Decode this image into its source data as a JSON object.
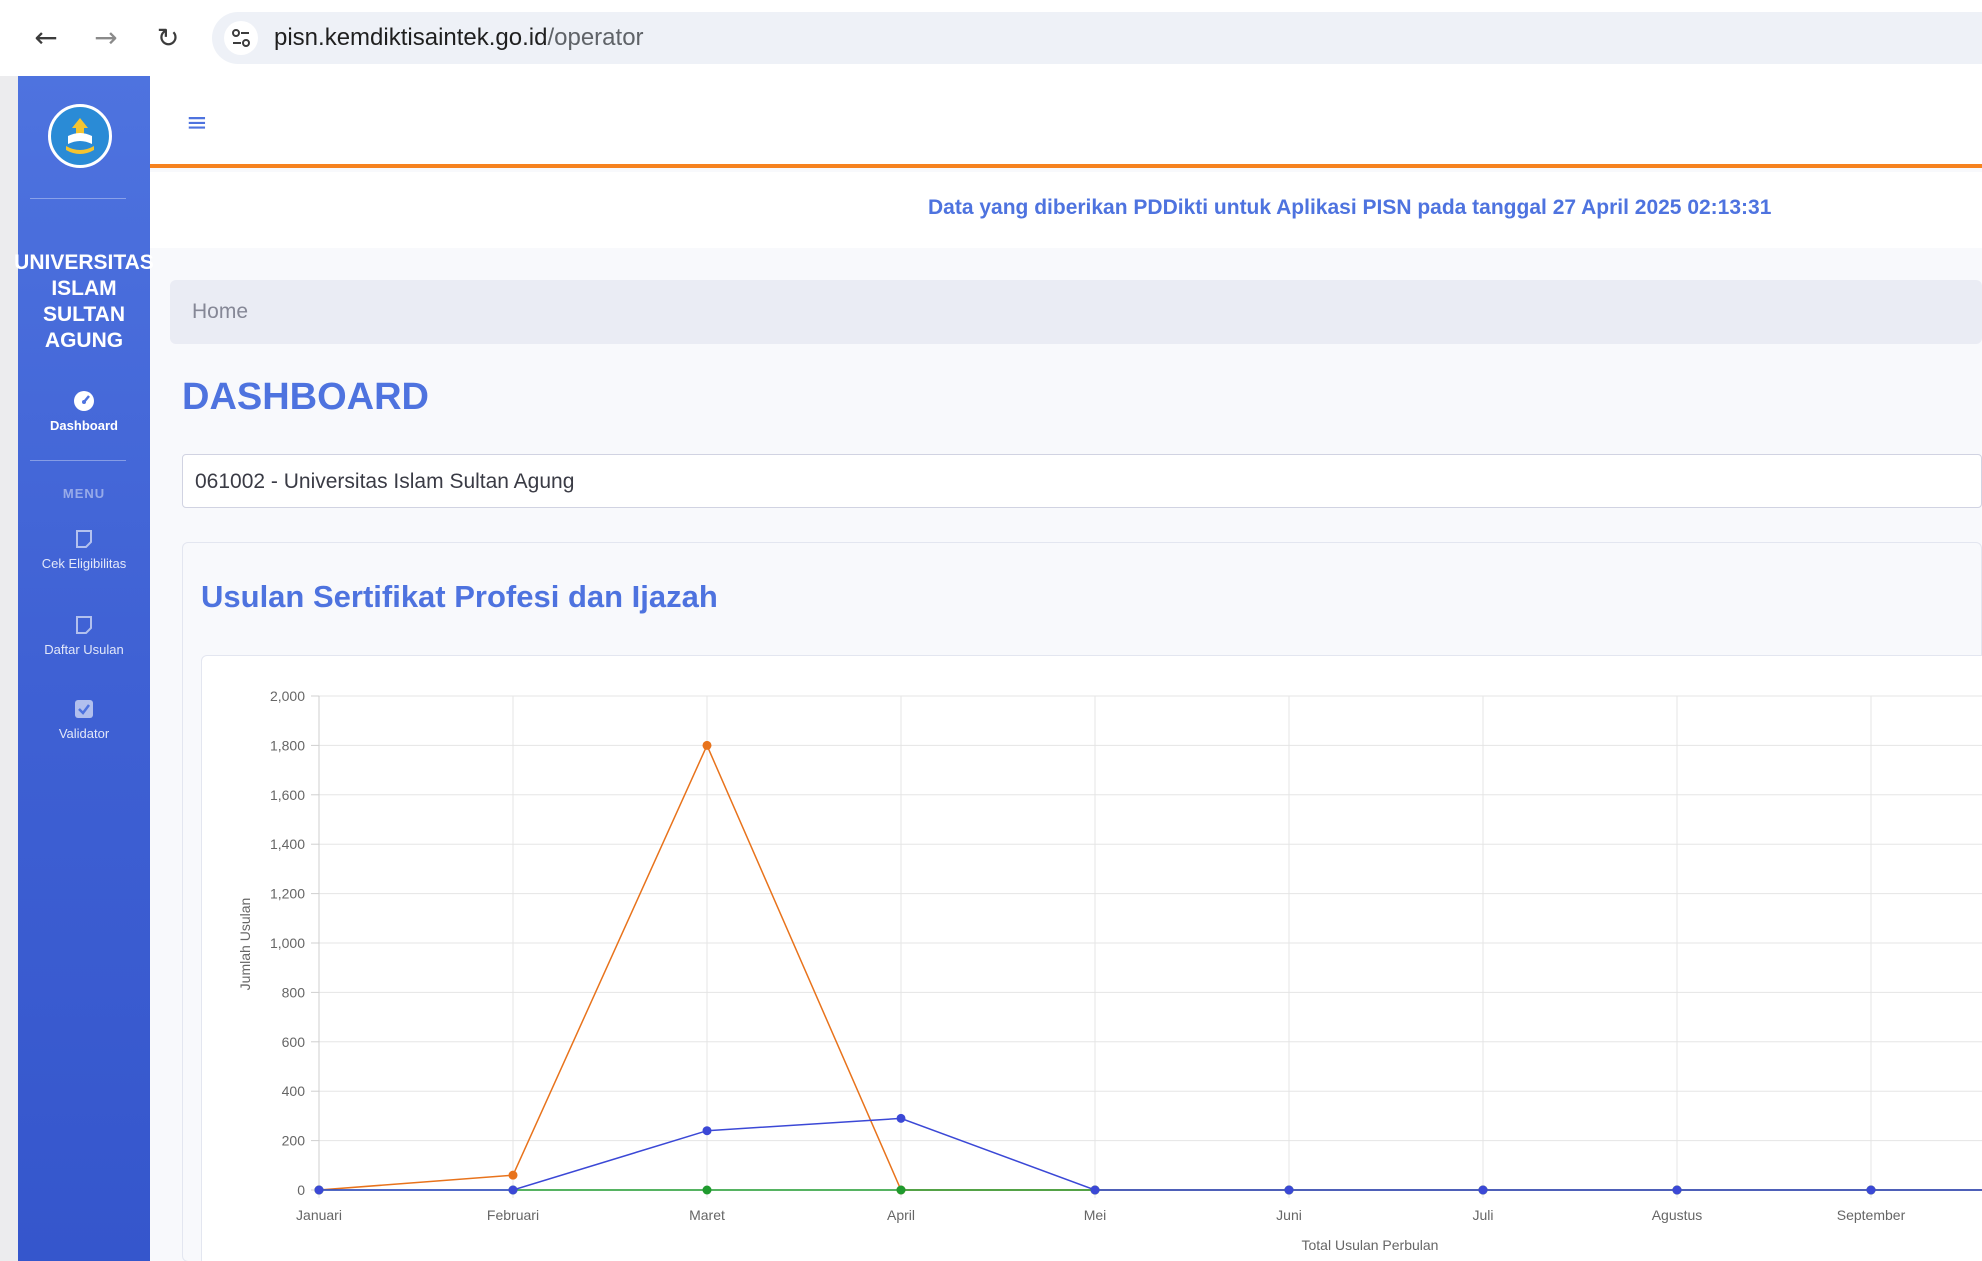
{
  "browser": {
    "url_host": "pisn.kemdiktisaintek.go.id",
    "url_path": "/operator"
  },
  "sidebar": {
    "institution": "UNIVERSITAS\nISLAM\nSULTAN\nAGUNG",
    "dashboard_label": "Dashboard",
    "menu_heading": "MENU",
    "items": [
      {
        "label": "Cek Eligibilitas",
        "icon": "document-icon"
      },
      {
        "label": "Daftar Usulan",
        "icon": "document-icon"
      },
      {
        "label": "Validator",
        "icon": "checkbox-icon"
      }
    ]
  },
  "header": {
    "info_text": "Data yang diberikan PDDikti untuk Aplikasi PISN pada tanggal 27 April 2025 02:13:31"
  },
  "breadcrumb": {
    "home": "Home"
  },
  "page": {
    "title": "DASHBOARD",
    "institution_select_value": "061002 - Universitas Islam Sultan Agung",
    "card_title": "Usulan Sertifikat Profesi dan Ijazah"
  },
  "colors": {
    "primary": "#4e73df",
    "accent_orange": "#f6821f",
    "series_orange": "#e8731c",
    "series_blue": "#3b48d6",
    "series_green": "#1f9a2e"
  },
  "chart_data": {
    "type": "line",
    "categories": [
      "Januari",
      "Februari",
      "Maret",
      "April",
      "Mei",
      "Juni",
      "Juli",
      "Agustus",
      "September"
    ],
    "series": [
      {
        "color": "#e8731c",
        "values": [
          0,
          60,
          1800,
          0,
          0,
          0,
          0,
          0,
          0
        ]
      },
      {
        "color": "#1f9a2e",
        "values": [
          0,
          0,
          0,
          0,
          0,
          0,
          0,
          0,
          0
        ]
      },
      {
        "color": "#3b48d6",
        "values": [
          0,
          0,
          240,
          290,
          0,
          0,
          0,
          0,
          0
        ]
      }
    ],
    "yticks": [
      "0",
      "200",
      "400",
      "600",
      "800",
      "1,000",
      "1,200",
      "1,400",
      "1,600",
      "1,800",
      "2,000"
    ],
    "ylim": [
      0,
      2000
    ],
    "ylabel": "Jumlah Usulan",
    "xlabel": "Total Usulan Perbulan",
    "grid": true
  }
}
